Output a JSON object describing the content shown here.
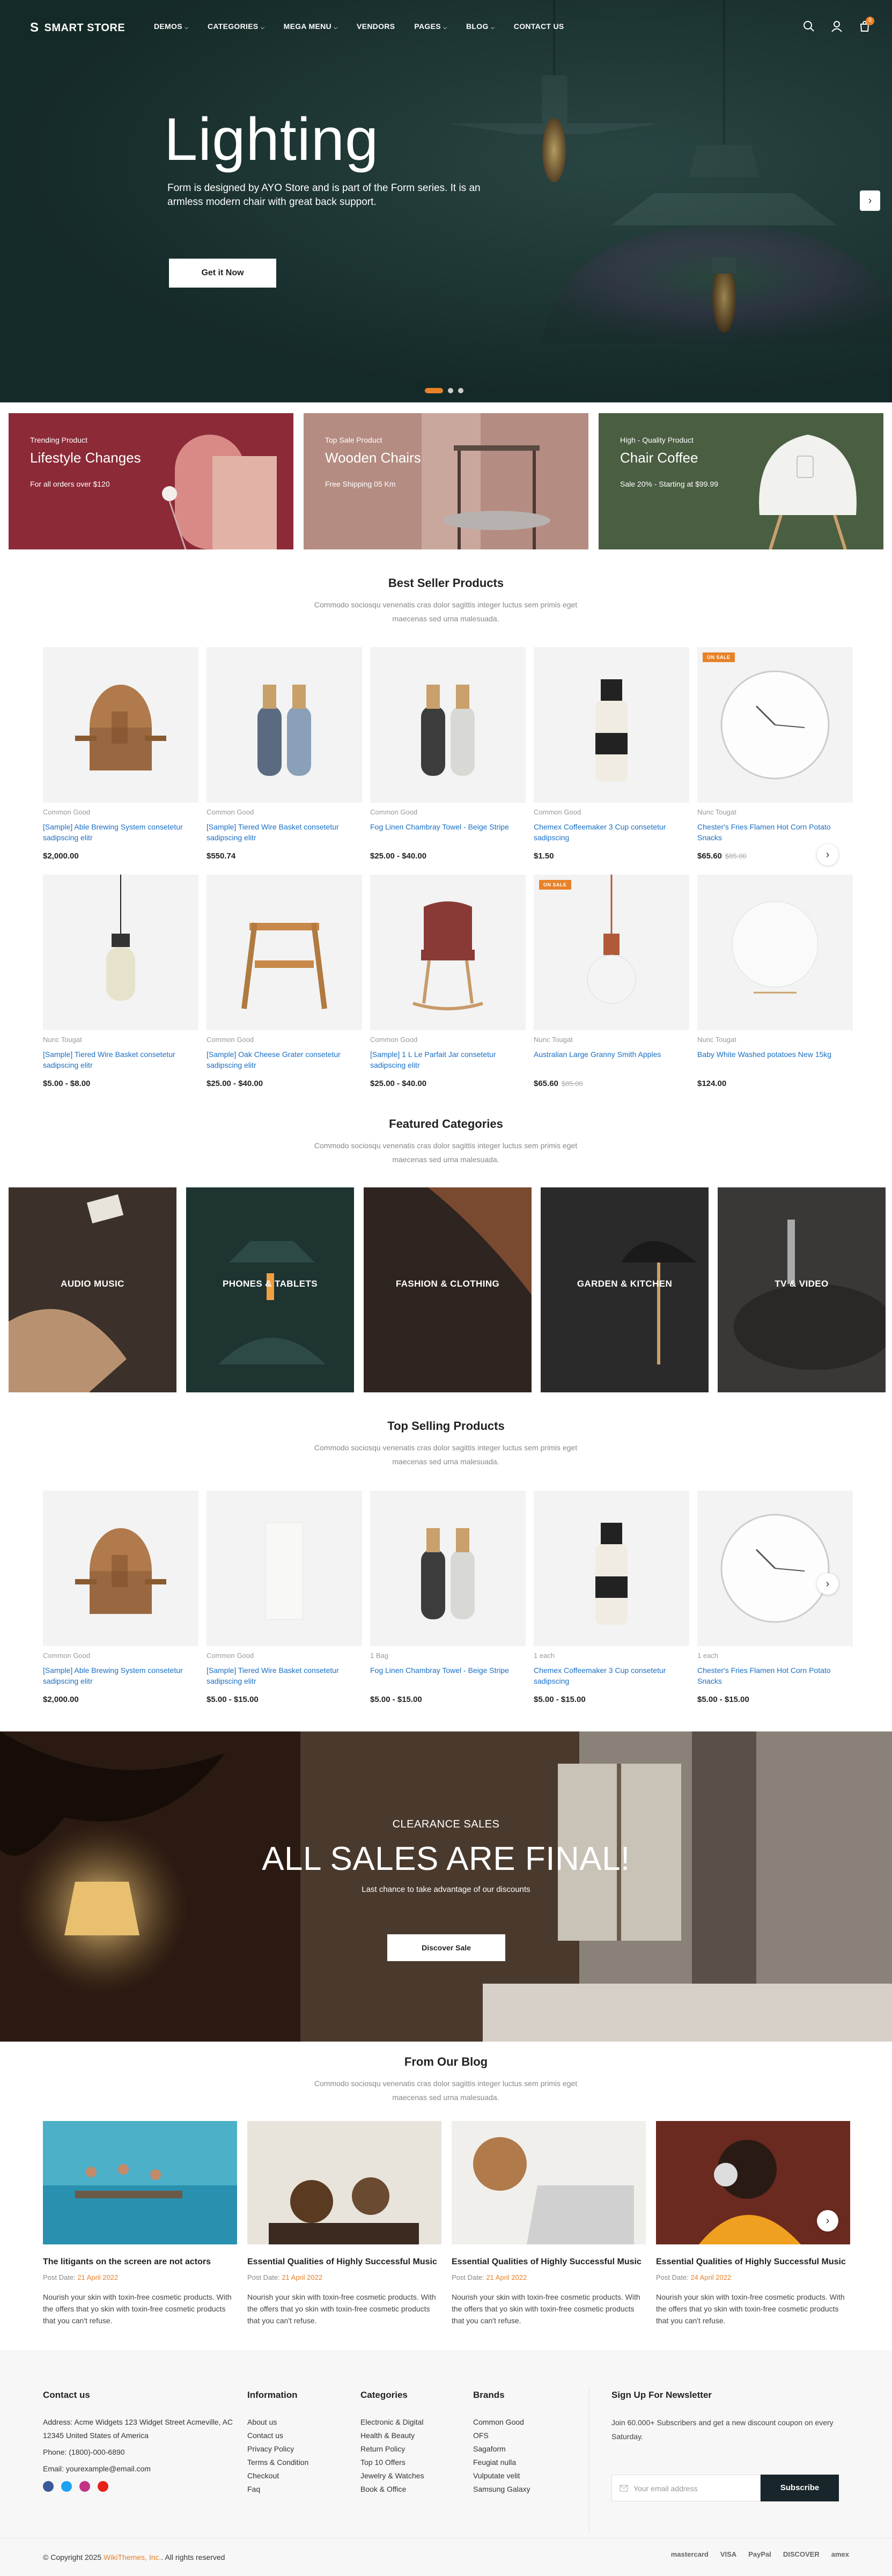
{
  "header": {
    "logo_mark": "S",
    "logo_text": "SMART STORE",
    "nav": [
      {
        "label": "DEMOS",
        "has_dropdown": true
      },
      {
        "label": "CATEGORIES",
        "has_dropdown": true
      },
      {
        "label": "MEGA MENU",
        "has_dropdown": true
      },
      {
        "label": "VENDORS",
        "has_dropdown": false
      },
      {
        "label": "PAGES",
        "has_dropdown": true
      },
      {
        "label": "BLOG",
        "has_dropdown": true
      },
      {
        "label": "CONTACT US",
        "has_dropdown": false
      }
    ],
    "cart_count": "0",
    "icons": [
      "search-icon",
      "user-icon",
      "cart-icon"
    ]
  },
  "hero": {
    "title": "Lighting",
    "description": "Form is designed by AYO Store and is part of the Form series. It is an armless modern chair with great back support.",
    "button": "Get it Now",
    "slides": 3,
    "active_slide": 0
  },
  "promos": [
    {
      "sub": "Trending Product",
      "title": "Lifestyle Changes",
      "desc": "For all orders over $120",
      "bg": "#8c2a37"
    },
    {
      "sub": "Top Sale Product",
      "title": "Wooden Chairs",
      "desc": "Free Shipping 05 Km",
      "bg": "#b58c82"
    },
    {
      "sub": "High - Quality Product",
      "title": "Chair Coffee",
      "desc": "Sale 20% - Starting at $99.99",
      "bg": "#4a5e42"
    }
  ],
  "best_seller": {
    "title": "Best Seller Products",
    "subtitle": "Commodo sociosqu venenatis cras dolor sagittis integer luctus sem primis eget maecenas sed urna malesuada.",
    "products": [
      {
        "vendor": "Common Good",
        "name": "[Sample] Able Brewing System consetetur sadipscing elitr",
        "price": "$2,000.00",
        "old": "",
        "badge": ""
      },
      {
        "vendor": "Common Good",
        "name": "[Sample] Tiered Wire Basket consetetur sadipscing elitr",
        "price": "$550.74",
        "old": "",
        "badge": ""
      },
      {
        "vendor": "Common Good",
        "name": "Fog Linen Chambray Towel - Beige Stripe",
        "price": "$25.00 - $40.00",
        "old": "",
        "badge": ""
      },
      {
        "vendor": "Common Good",
        "name": "Chemex Coffeemaker 3 Cup consetetur sadipscing",
        "price": "$1.50",
        "old": "",
        "badge": ""
      },
      {
        "vendor": "Nunc Tougat",
        "name": "Chester's Fries Flamen Hot Corn Potato Snacks",
        "price": "$65.60",
        "old": "$85.00",
        "badge": "ON SALE"
      },
      {
        "vendor": "Nunc Tougat",
        "name": "[Sample] Tiered Wire Basket consetetur sadipscing elitr",
        "price": "$5.00 - $8.00",
        "old": "",
        "badge": ""
      },
      {
        "vendor": "Common Good",
        "name": "[Sample] Oak Cheese Grater consetetur sadipscing elitr",
        "price": "$25.00 - $40.00",
        "old": "",
        "badge": ""
      },
      {
        "vendor": "Common Good",
        "name": "[Sample] 1 L Le Parfait Jar consetetur sadipscing elitr",
        "price": "$25.00 - $40.00",
        "old": "",
        "badge": ""
      },
      {
        "vendor": "Nunc Tougat",
        "name": "Australian Large Granny Smith Apples",
        "price": "$65.60",
        "old": "$85.00",
        "badge": "ON SALE"
      },
      {
        "vendor": "Nunc Tougat",
        "name": "Baby White Washed potatoes New 15kg",
        "price": "$124.00",
        "old": "",
        "badge": ""
      }
    ]
  },
  "featured": {
    "title": "Featured Categories",
    "subtitle": "Commodo sociosqu venenatis cras dolor sagittis integer luctus sem primis eget maecenas sed urna malesuada.",
    "categories": [
      {
        "label": "AUDIO MUSIC",
        "bg": "#3b302a"
      },
      {
        "label": "PHONES & TABLETS",
        "bg": "#1d3431"
      },
      {
        "label": "FASHION & CLOTHING",
        "bg": "#2e2420"
      },
      {
        "label": "GARDEN & KITCHEN",
        "bg": "#2a2a2a"
      },
      {
        "label": "TV & VIDEO",
        "bg": "#3a3836"
      }
    ]
  },
  "top_selling": {
    "title": "Top Selling Products",
    "subtitle": "Commodo sociosqu venenatis cras dolor sagittis integer luctus sem primis eget maecenas sed urna malesuada.",
    "products": [
      {
        "vendor": "Common Good",
        "name": "[Sample] Able Brewing System consetetur sadipscing elitr",
        "price": "$2,000.00"
      },
      {
        "vendor": "Common Good",
        "name": "[Sample] Tiered Wire Basket consetetur sadipscing elitr",
        "price": "$5.00 - $15.00"
      },
      {
        "vendor": "1 Bag",
        "name": "Fog Linen Chambray Towel - Beige Stripe",
        "price": "$5.00 - $15.00"
      },
      {
        "vendor": "1 each",
        "name": "Chemex Coffeemaker 3 Cup consetetur sadipscing",
        "price": "$5.00 - $15.00"
      },
      {
        "vendor": "1 each",
        "name": "Chester's Fries Flamen Hot Corn Potato Snacks",
        "price": "$5.00 - $15.00"
      }
    ]
  },
  "clearance": {
    "kicker": "CLEARANCE SALES",
    "title": "ALL SALES ARE FINAL!",
    "desc": "Last chance to take advantage of our discounts",
    "button": "Discover Sale"
  },
  "blog": {
    "title": "From Our Blog",
    "subtitle": "Commodo sociosqu venenatis cras dolor sagittis integer luctus sem primis eget maecenas sed urna malesuada.",
    "posts": [
      {
        "title": "The litigants on the screen are not actors",
        "date_label": "Post Date:",
        "date": "21 April 2022",
        "excerpt": "Nourish your skin with toxin-free cosmetic products. With the offers that yo skin with toxin-free cosmetic products that you can't refuse."
      },
      {
        "title": "Essential Qualities of Highly Successful Music",
        "date_label": "Post Date:",
        "date": "21 April 2022",
        "excerpt": "Nourish your skin with toxin-free cosmetic products. With the offers that yo skin with toxin-free cosmetic products that you can't refuse."
      },
      {
        "title": "Essential Qualities of Highly Successful Music",
        "date_label": "Post Date:",
        "date": "21 April 2022",
        "excerpt": "Nourish your skin with toxin-free cosmetic products. With the offers that yo skin with toxin-free cosmetic products that you can't refuse."
      },
      {
        "title": "Essential Qualities of Highly Successful Music",
        "date_label": "Post Date:",
        "date": "24 April 2022",
        "excerpt": "Nourish your skin with toxin-free cosmetic products. With the offers that yo skin with toxin-free cosmetic products that you can't refuse."
      }
    ]
  },
  "footer": {
    "contact": {
      "title": "Contact us",
      "address": "Address: Acme Widgets 123 Widget Street Acmeville, AC 12345 United States of America",
      "phone": "Phone: (1800)-000-6890",
      "email": "Email: yourexample@email.com"
    },
    "information": {
      "title": "Information",
      "items": [
        "About us",
        "Contact us",
        "Privacy Policy",
        "Terms & Condition",
        "Checkout",
        "Faq"
      ]
    },
    "categories": {
      "title": "Categories",
      "items": [
        "Electronic & Digital",
        "Health & Beauty",
        "Return Policy",
        "Top 10 Offers",
        "Jewelry & Watches",
        "Book & Office"
      ]
    },
    "brands": {
      "title": "Brands",
      "items": [
        "Common Good",
        "OFS",
        "Sagaform",
        "Feugiat nulla",
        "Vulputate velit",
        "Samsung Galaxy"
      ]
    },
    "newsletter": {
      "title": "Sign Up For Newsletter",
      "desc": "Join 60.000+ Subscribers and get a new discount coupon on every Saturday.",
      "placeholder": "Your email address",
      "button": "Subscribe"
    },
    "copyright_prefix": "© Copyright 2025",
    "copyright_brand": "WikiThemes, Inc.",
    "copyright_suffix": "All rights reserved",
    "payments": [
      "mastercard",
      "VISA",
      "PayPal",
      "DISCOVER",
      "amex"
    ]
  }
}
